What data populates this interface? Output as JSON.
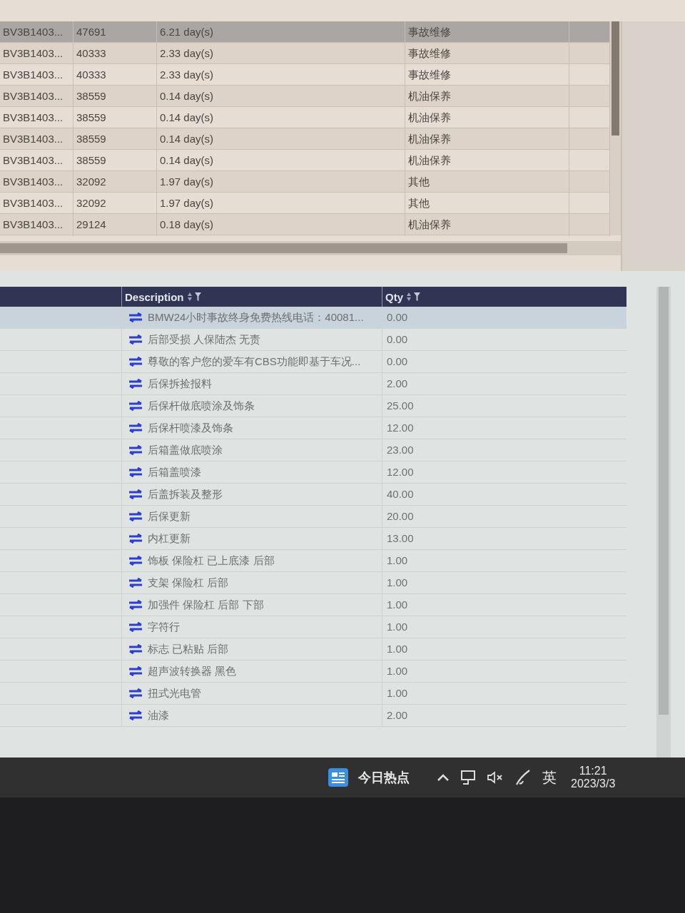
{
  "orders_table": {
    "rows": [
      {
        "cells": [
          "BV3B1403...",
          "47691",
          "6.21 day(s)",
          "事故维修"
        ],
        "selected": true
      },
      {
        "cells": [
          "BV3B1403...",
          "40333",
          "2.33 day(s)",
          "事故维修"
        ],
        "selected": false
      },
      {
        "cells": [
          "BV3B1403...",
          "40333",
          "2.33 day(s)",
          "事故维修"
        ],
        "selected": false
      },
      {
        "cells": [
          "BV3B1403...",
          "38559",
          "0.14 day(s)",
          "机油保养"
        ],
        "selected": false
      },
      {
        "cells": [
          "BV3B1403...",
          "38559",
          "0.14 day(s)",
          "机油保养"
        ],
        "selected": false
      },
      {
        "cells": [
          "BV3B1403...",
          "38559",
          "0.14 day(s)",
          "机油保养"
        ],
        "selected": false
      },
      {
        "cells": [
          "BV3B1403...",
          "38559",
          "0.14 day(s)",
          "机油保养"
        ],
        "selected": false
      },
      {
        "cells": [
          "BV3B1403...",
          "32092",
          "1.97 day(s)",
          "其他"
        ],
        "selected": false
      },
      {
        "cells": [
          "BV3B1403...",
          "32092",
          "1.97 day(s)",
          "其他"
        ],
        "selected": false
      },
      {
        "cells": [
          "BV3B1403...",
          "29124",
          "0.18 day(s)",
          "机油保养"
        ],
        "selected": false
      }
    ]
  },
  "items_table": {
    "columns": [
      {
        "label": "Description"
      },
      {
        "label": "Qty"
      }
    ],
    "rows": [
      {
        "description": "BMW24小时事故终身免费热线电话：40081...",
        "qty": "0.00",
        "selected": true
      },
      {
        "description": "后部受损 人保陆杰 无责",
        "qty": "0.00",
        "selected": false
      },
      {
        "description": "尊敬的客户您的爱车有CBS功能即基于车况...",
        "qty": "0.00",
        "selected": false
      },
      {
        "description": "后保拆捡报料",
        "qty": "2.00",
        "selected": false
      },
      {
        "description": "后保杆做底喷涂及饰条",
        "qty": "25.00",
        "selected": false
      },
      {
        "description": "后保杆喷漆及饰条",
        "qty": "12.00",
        "selected": false
      },
      {
        "description": "后箱盖做底喷涂",
        "qty": "23.00",
        "selected": false
      },
      {
        "description": "后箱盖喷漆",
        "qty": "12.00",
        "selected": false
      },
      {
        "description": "后盖拆装及整形",
        "qty": "40.00",
        "selected": false
      },
      {
        "description": "后保更新",
        "qty": "20.00",
        "selected": false
      },
      {
        "description": "内杠更新",
        "qty": "13.00",
        "selected": false
      },
      {
        "description": "饰板 保险杠 已上底漆 后部",
        "qty": "1.00",
        "selected": false
      },
      {
        "description": "支架 保险杠 后部",
        "qty": "1.00",
        "selected": false
      },
      {
        "description": "加强件 保险杠 后部 下部",
        "qty": "1.00",
        "selected": false
      },
      {
        "description": "字符行",
        "qty": "1.00",
        "selected": false
      },
      {
        "description": "标志 已粘贴 后部",
        "qty": "1.00",
        "selected": false
      },
      {
        "description": "超声波转换器 黑色",
        "qty": "1.00",
        "selected": false
      },
      {
        "description": "扭式光电管",
        "qty": "1.00",
        "selected": false
      },
      {
        "description": "油漆",
        "qty": "2.00",
        "selected": false
      }
    ]
  },
  "taskbar": {
    "news_label": "今日热点",
    "input_method": "英",
    "time": "11:21",
    "date": "2023/3/3"
  }
}
